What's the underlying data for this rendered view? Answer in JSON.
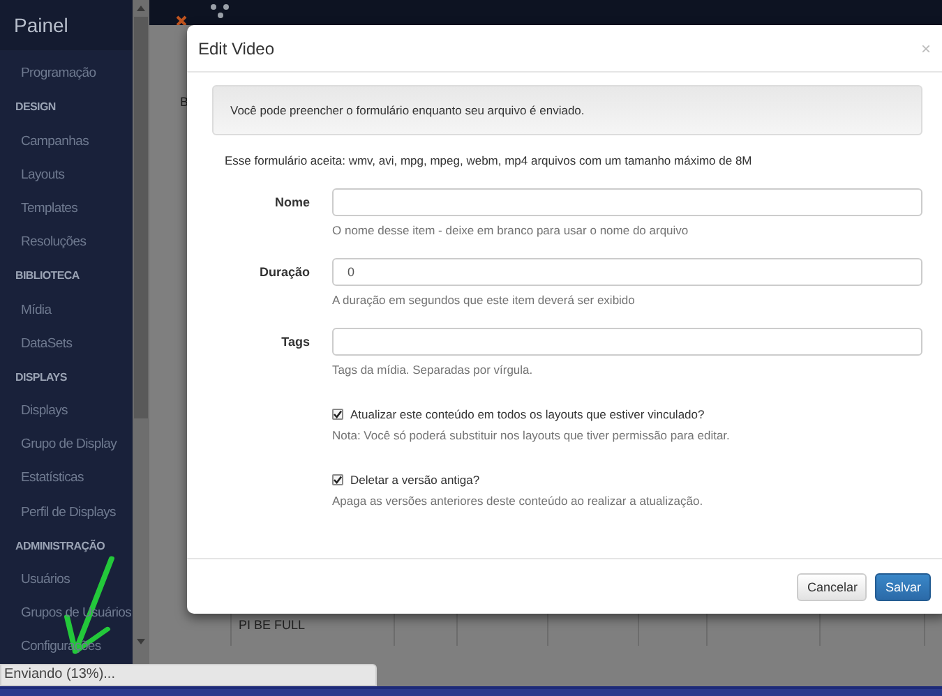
{
  "sidebar": {
    "title": "Painel",
    "items": [
      {
        "kind": "link",
        "label": "Programação"
      },
      {
        "kind": "heading",
        "label": "DESIGN"
      },
      {
        "kind": "link",
        "label": "Campanhas"
      },
      {
        "kind": "link",
        "label": "Layouts"
      },
      {
        "kind": "link",
        "label": "Templates"
      },
      {
        "kind": "link",
        "label": "Resoluções"
      },
      {
        "kind": "heading",
        "label": "BIBLIOTECA"
      },
      {
        "kind": "link",
        "label": "Mídia"
      },
      {
        "kind": "link",
        "label": "DataSets"
      },
      {
        "kind": "heading",
        "label": "DISPLAYS"
      },
      {
        "kind": "link",
        "label": "Displays"
      },
      {
        "kind": "link",
        "label": "Grupo de Display"
      },
      {
        "kind": "link",
        "label": "Estatísticas"
      },
      {
        "kind": "link",
        "label": "Perfil de Displays"
      },
      {
        "kind": "heading",
        "label": "ADMINISTRAÇÃO"
      },
      {
        "kind": "link",
        "label": "Usuários"
      },
      {
        "kind": "link",
        "label": "Grupos de Usuários"
      },
      {
        "kind": "link",
        "label": "Configurações"
      }
    ]
  },
  "background": {
    "breadcrumb": "B",
    "table_cell": "PI BE FULL"
  },
  "dialog": {
    "title": "Edit Video",
    "close": "×",
    "alert": "Você pode preencher o formulário enquanto seu arquivo é enviado.",
    "intro": "Esse formulário aceita: wmv, avi, mpg, mpeg, webm, mp4 arquivos com um tamanho máximo de 8M",
    "fields": [
      {
        "label": "Nome",
        "help": "O nome desse item - deixe em branco para usar o nome do arquivo"
      },
      {
        "label": "Duração",
        "value": "0",
        "help": "A duração em segundos que este item deverá ser exibido"
      },
      {
        "label": "Tags",
        "help": "Tags da mídia. Separadas por vírgula."
      }
    ],
    "checkboxes": [
      {
        "label": "Atualizar este conteúdo em todos os layouts que estiver vinculado?",
        "checked": true,
        "help": "Nota: Você só poderá substituir nos layouts que tiver permissão para editar."
      },
      {
        "label": "Deletar a versão antiga?",
        "checked": true,
        "help": "Apaga as versões anteriores deste conteúdo ao realizar a atualização."
      }
    ],
    "buttons": [
      {
        "kind": "default",
        "label": "Cancelar"
      },
      {
        "kind": "primary",
        "label": "Salvar"
      }
    ]
  },
  "status_bar": {
    "text": "Enviando (13%)..."
  }
}
